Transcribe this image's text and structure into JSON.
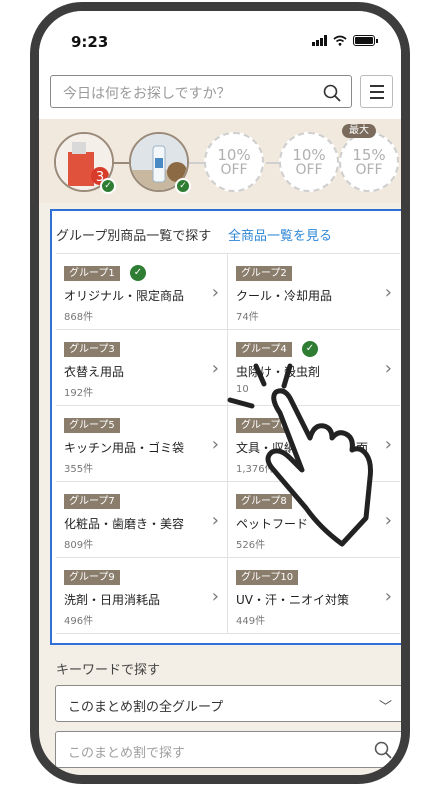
{
  "status": {
    "time": "9:23"
  },
  "header": {
    "search_placeholder": "今日は何をお探しですか？"
  },
  "rewards": {
    "max_label": "最大",
    "stamps": [
      {
        "kind": "image",
        "badge": "3",
        "checked": true
      },
      {
        "kind": "image",
        "checked": true
      },
      {
        "kind": "discount",
        "percent": "10%",
        "label": "OFF"
      },
      {
        "kind": "discount",
        "percent": "10%",
        "label": "OFF"
      },
      {
        "kind": "discount",
        "percent": "15%",
        "label": "OFF"
      }
    ]
  },
  "groups": {
    "title": "グループ別商品一覧で探す",
    "link": "全商品一覧を見る",
    "items": [
      {
        "tag": "グループ1",
        "name": "オリジナル・限定商品",
        "count": "868件",
        "checked": true
      },
      {
        "tag": "グループ2",
        "name": "クール・冷却用品",
        "count": "74件",
        "checked": false
      },
      {
        "tag": "グループ3",
        "name": "衣替え用品",
        "count": "192件",
        "checked": false
      },
      {
        "tag": "グループ4",
        "name": "虫除け・殺虫剤",
        "count": "10",
        "checked": true
      },
      {
        "tag": "グループ5",
        "name": "キッチン用品・ゴミ袋",
        "count": "355件",
        "checked": false
      },
      {
        "tag": "グループ6",
        "name": "文具・収納・掃除・洗面",
        "count": "1,376件",
        "checked": false
      },
      {
        "tag": "グループ7",
        "name": "化粧品・歯磨き・美容",
        "count": "809件",
        "checked": false
      },
      {
        "tag": "グループ8",
        "name": "ペットフード",
        "count": "526件",
        "checked": false
      },
      {
        "tag": "グループ9",
        "name": "洗剤・日用消耗品",
        "count": "496件",
        "checked": false
      },
      {
        "tag": "グループ10",
        "name": "UV・汗・ニオイ対策",
        "count": "449件",
        "checked": false
      }
    ]
  },
  "keyword": {
    "label": "キーワードで探す",
    "select_value": "このまとめ割の全グループ",
    "input_placeholder": "このまとめ割で探す"
  },
  "colors": {
    "accent_blue": "#2f6fd6",
    "tag_brown": "#8b7d6c",
    "check_green": "#2e7d32",
    "bg_beige": "#f1e9dd"
  }
}
